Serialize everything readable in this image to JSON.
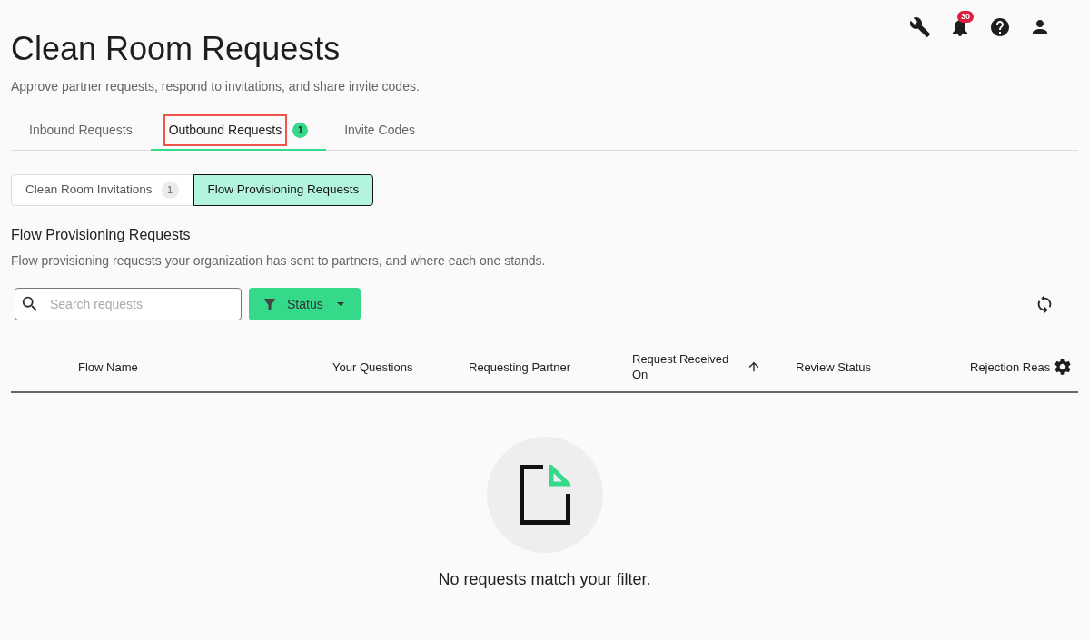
{
  "header": {
    "notifications_badge": "30"
  },
  "page": {
    "title": "Clean Room Requests",
    "subtitle": "Approve partner requests, respond to invitations, and share invite codes."
  },
  "tabs": [
    {
      "label": "Inbound Requests",
      "selected": false,
      "highlighted": false
    },
    {
      "label": "Outbound Requests",
      "selected": true,
      "highlighted": true,
      "badge": "1"
    },
    {
      "label": "Invite Codes",
      "selected": false,
      "highlighted": false
    }
  ],
  "sub_tabs": [
    {
      "label": "Clean Room Invitations",
      "selected": false,
      "badge": "1"
    },
    {
      "label": "Flow Provisioning Requests",
      "selected": true
    }
  ],
  "section": {
    "title": "Flow Provisioning Requests",
    "description": "Flow provisioning requests your organization has sent to partners, and where each one stands."
  },
  "search": {
    "placeholder": "Search requests"
  },
  "filter_button": {
    "label": "Status"
  },
  "table": {
    "columns": [
      {
        "label": "Flow Name",
        "sorted": false
      },
      {
        "label": "Your Questions",
        "sorted": false
      },
      {
        "label": "Requesting Partner",
        "sorted": false
      },
      {
        "label": "Request Received On",
        "sorted": true
      },
      {
        "label": "Review Status",
        "sorted": false
      },
      {
        "label": "Rejection Reas",
        "sorted": false
      }
    ]
  },
  "empty_state": {
    "message": "No requests match your filter."
  }
}
